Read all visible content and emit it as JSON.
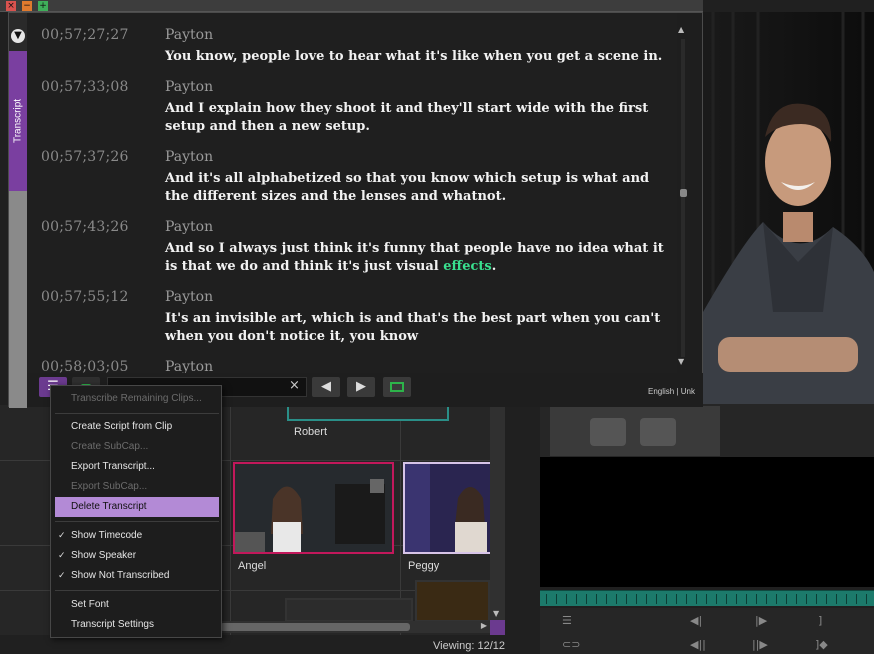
{
  "transcript_tab_label": "Transcript",
  "entries": [
    {
      "timecode": "00;57;27;27",
      "speaker": "Payton",
      "text": "You know, people love to hear what it's like when you get a scene in."
    },
    {
      "timecode": "00;57;33;08",
      "speaker": "Payton",
      "text": "And I explain how they shoot it and they'll start wide with the first setup and then a new setup."
    },
    {
      "timecode": "00;57;37;26",
      "speaker": "Payton",
      "text": "And it's all alphabetized so that you know which setup is what and the different sizes and the lenses and whatnot."
    },
    {
      "timecode": "00;57;43;26",
      "speaker": "Payton",
      "text_before": "And so I always just think it's funny that people have no idea what it is that we do and think it's just visual ",
      "highlight": "effects",
      "text_after": "."
    },
    {
      "timecode": "00;57;55;12",
      "speaker": "Payton",
      "text": "It's an invisible art, which is and that's the best part when you can't when you don't notice it, you know"
    },
    {
      "timecode": "00;58;03;05",
      "speaker": "Payton",
      "text": ""
    }
  ],
  "toolbar": {
    "clear_icon": "×",
    "language": "English | Unk"
  },
  "context_menu": {
    "items": [
      {
        "label": "Transcribe Remaining Clips...",
        "enabled": false
      },
      {
        "label": "Create Script from Clip",
        "enabled": true
      },
      {
        "label": "Create SubCap...",
        "enabled": false
      },
      {
        "label": "Export Transcript...",
        "enabled": true
      },
      {
        "label": "Export SubCap...",
        "enabled": false
      },
      {
        "label": "Delete Transcript",
        "enabled": true,
        "highlighted": true
      },
      {
        "label": "Show Timecode",
        "enabled": true,
        "checked": true
      },
      {
        "label": "Show Speaker",
        "enabled": true,
        "checked": true
      },
      {
        "label": "Show Not Transcribed",
        "enabled": true,
        "checked": true
      },
      {
        "label": "Set Font",
        "enabled": true
      },
      {
        "label": "Transcript Settings",
        "enabled": true
      }
    ]
  },
  "bin": {
    "clips": [
      {
        "label": "Robert"
      },
      {
        "label": "Angel"
      },
      {
        "label": "Peggy"
      }
    ],
    "status": "Viewing: 12/12"
  },
  "colors": {
    "accent_purple": "#7a3fa0",
    "menu_highlight": "#b38ad6",
    "word_highlight": "#39e08f",
    "clip_border": "#c2185b",
    "scrub_bar": "#1c7a6b"
  }
}
